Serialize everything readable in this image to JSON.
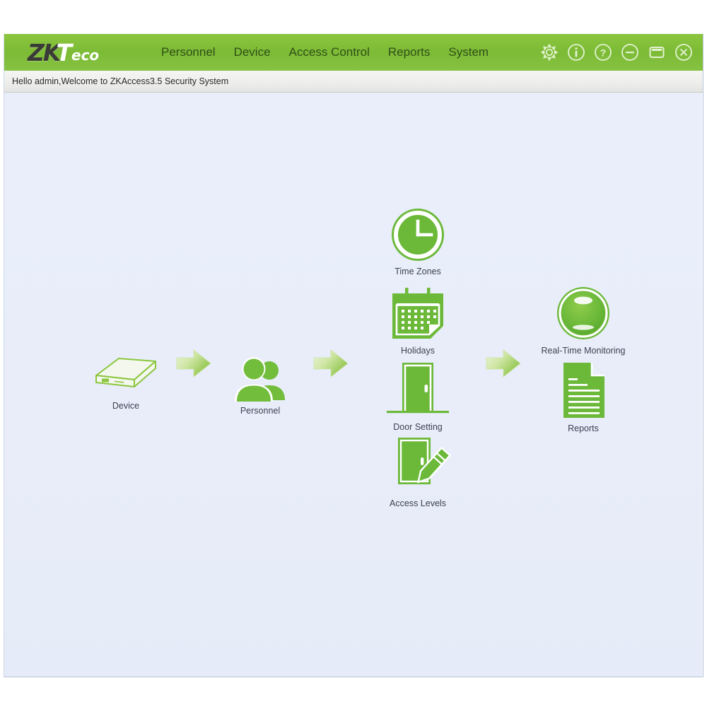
{
  "app": {
    "logo_primary": "ZK",
    "logo_secondary": "T",
    "logo_suffix": "eco",
    "accent_color": "#82c341",
    "menu_text_color": "#2f4f17",
    "workspace_bg": "#e9eefa"
  },
  "menu": {
    "items": [
      {
        "label": "Personnel"
      },
      {
        "label": "Device"
      },
      {
        "label": "Access Control"
      },
      {
        "label": "Reports"
      },
      {
        "label": "System"
      }
    ]
  },
  "window_controls": [
    {
      "name": "settings-gear-icon",
      "glyph": "gear"
    },
    {
      "name": "info-icon",
      "glyph": "info"
    },
    {
      "name": "help-icon",
      "glyph": "help"
    },
    {
      "name": "minimize-button",
      "glyph": "minimize"
    },
    {
      "name": "maximize-button",
      "glyph": "maximize"
    },
    {
      "name": "close-button",
      "glyph": "close"
    }
  ],
  "welcome": {
    "message": "Hello admin,Welcome to ZKAccess3.5 Security System"
  },
  "workflow": {
    "nodes": [
      {
        "id": "device",
        "label": "Device",
        "icon": "device-box-icon"
      },
      {
        "id": "personnel",
        "label": "Personnel",
        "icon": "people-icon"
      },
      {
        "id": "timezones",
        "label": "Time Zones",
        "icon": "clock-icon"
      },
      {
        "id": "holidays",
        "label": "Holidays",
        "icon": "calendar-icon"
      },
      {
        "id": "door",
        "label": "Door Setting",
        "icon": "door-icon"
      },
      {
        "id": "levels",
        "label": "Access Levels",
        "icon": "door-pencil-icon"
      },
      {
        "id": "rtm",
        "label": "Real-Time Monitoring",
        "icon": "monitor-orb-icon"
      },
      {
        "id": "reports",
        "label": "Reports",
        "icon": "document-icon"
      }
    ],
    "arrows": [
      {
        "id": "arrow-device-to-personnel"
      },
      {
        "id": "arrow-personnel-to-accesscontrol"
      },
      {
        "id": "arrow-accesscontrol-to-monitoring"
      }
    ]
  }
}
